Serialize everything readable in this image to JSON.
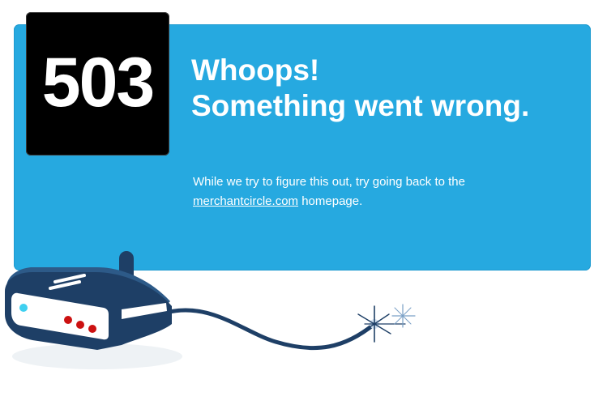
{
  "error": {
    "code": "503",
    "headline_line1": "Whoops!",
    "headline_line2": "Something went wrong."
  },
  "message": {
    "text_before_link": "While we try to figure this out, try going back to the ",
    "link_text": "merchantcircle.com",
    "text_after_link": " homepage."
  },
  "colors": {
    "banner": "#26a9e0",
    "code_box": "#000000",
    "router": "#1e3f66",
    "router_led_blue": "#3fd0f0",
    "router_led_red": "#cc1111"
  },
  "icons": {
    "router": "router-icon",
    "spark": "spark-icon"
  }
}
